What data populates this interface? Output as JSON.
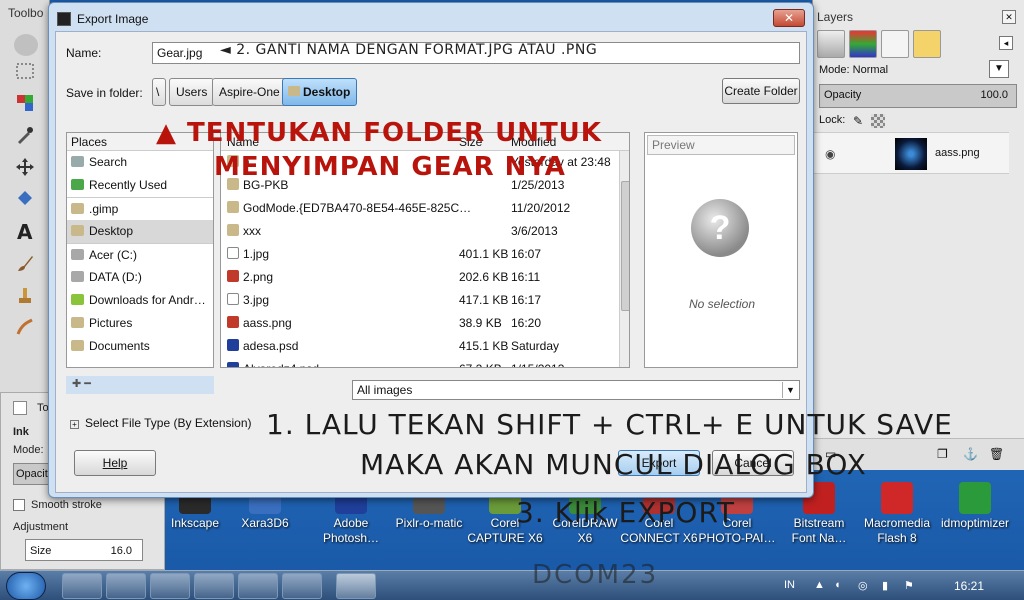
{
  "toolbox": {
    "title": "Toolbo",
    "options": {
      "tab_label": "To",
      "ink_label": "Ink",
      "mode_label": "Mode:",
      "opacity_label": "Opacit",
      "smooth_label": "Smooth stroke",
      "adjustment_label": "Adjustment",
      "size_label": "Size",
      "size_value": "16.0"
    }
  },
  "layers": {
    "title": "Layers",
    "mode_label": "Mode:",
    "mode_value": "Normal",
    "opacity_label": "Opacity",
    "opacity_value": "100.0",
    "lock_label": "Lock:",
    "layer_name": "aass.png"
  },
  "dialog": {
    "title": "Export Image",
    "close_label": "✕",
    "name_label": "Name:",
    "name_value": "Gear.jpg",
    "folder_label": "Save in folder:",
    "breadcrumbs": [
      "\\",
      "Users",
      "Aspire-One",
      "Desktop"
    ],
    "create_folder_label": "Create Folder",
    "places_header": "Places",
    "places": [
      {
        "label": "Search",
        "icon": "search-icon"
      },
      {
        "label": "Recently Used",
        "icon": "clock-icon"
      },
      {
        "label": ".gimp",
        "icon": "folder-icon"
      },
      {
        "label": "Desktop",
        "icon": "folder-icon"
      },
      {
        "label": "Acer (C:)",
        "icon": "drive-icon"
      },
      {
        "label": "DATA (D:)",
        "icon": "drive-icon"
      },
      {
        "label": "Downloads for Andr…",
        "icon": "android-icon"
      },
      {
        "label": "Pictures",
        "icon": "folder-icon"
      },
      {
        "label": "Documents",
        "icon": "folder-icon"
      }
    ],
    "add_remove": "✚   ━",
    "file_columns": {
      "name": "Name",
      "size": "Size",
      "modified": "Modified"
    },
    "files": [
      {
        "name": "a",
        "size": "",
        "modified": "Yesterday at 23:48",
        "type": "folder"
      },
      {
        "name": "BG-PKB",
        "size": "",
        "modified": "1/25/2013",
        "type": "folder"
      },
      {
        "name": "GodMode.{ED7BA470-8E54-465E-825C…",
        "size": "",
        "modified": "11/20/2012",
        "type": "folder"
      },
      {
        "name": "xxx",
        "size": "",
        "modified": "3/6/2013",
        "type": "folder"
      },
      {
        "name": "1.jpg",
        "size": "401.1 KB",
        "modified": "16:07",
        "type": "jpg"
      },
      {
        "name": "2.png",
        "size": "202.6 KB",
        "modified": "16:11",
        "type": "png"
      },
      {
        "name": "3.jpg",
        "size": "417.1 KB",
        "modified": "16:17",
        "type": "jpg"
      },
      {
        "name": "aass.png",
        "size": "38.9 KB",
        "modified": "16:20",
        "type": "png"
      },
      {
        "name": "adesa.psd",
        "size": "415.1 KB",
        "modified": "Saturday",
        "type": "psd"
      },
      {
        "name": "Alvarodz4.psd",
        "size": "67.2 KB",
        "modified": "1/15/2013",
        "type": "psd"
      }
    ],
    "preview_label": "Preview",
    "preview_icon": "question-mark-icon",
    "no_selection": "No selection",
    "filter_value": "All images",
    "file_type_label": "Select File Type (By Extension)",
    "help_label": "Help",
    "export_label": "Export",
    "cancel_label": "Cancel"
  },
  "annotations": {
    "step2": "◄ 2. GANTI NAMA DENGAN FORMAT.JPG ATAU .PNG",
    "folder_line1": "▲ TENTUKAN FOLDER UNTUK",
    "folder_line2": "MENYIMPAN GEAR NYA",
    "step1_line1": "1. LALU TEKAN SHIFT + CTRL+ E UNTUK SAVE",
    "step1_line2": "MAKA AKAN MUNCUL DIALOG BOX",
    "step3": "3. Klik EXPORT",
    "watermark": "DCOM23"
  },
  "desktop_icons": [
    {
      "label": "Inkscape",
      "color": "#2a2a2a"
    },
    {
      "label": "Xara3D6",
      "color": "#3a6fbf"
    },
    {
      "label": "Adobe Photosh…",
      "color": "#1f3f9a"
    },
    {
      "label": "Pixlr-o-matic",
      "color": "#555555"
    },
    {
      "label": "Corel CAPTURE X6",
      "color": "#6a9b3a"
    },
    {
      "label": "CorelDRAW X6",
      "color": "#3a8a3a"
    },
    {
      "label": "Corel CONNECT X6",
      "color": "#b03030"
    },
    {
      "label": "Corel PHOTO-PAI…",
      "color": "#c04040"
    },
    {
      "label": "Bitstream Font Na…",
      "color": "#c02020"
    },
    {
      "label": "Macromedia Flash 8",
      "color": "#d02828"
    },
    {
      "label": "idmoptimizer",
      "color": "#2a9a3a"
    }
  ],
  "taskbar": {
    "language": "IN",
    "clock": "16:21"
  }
}
